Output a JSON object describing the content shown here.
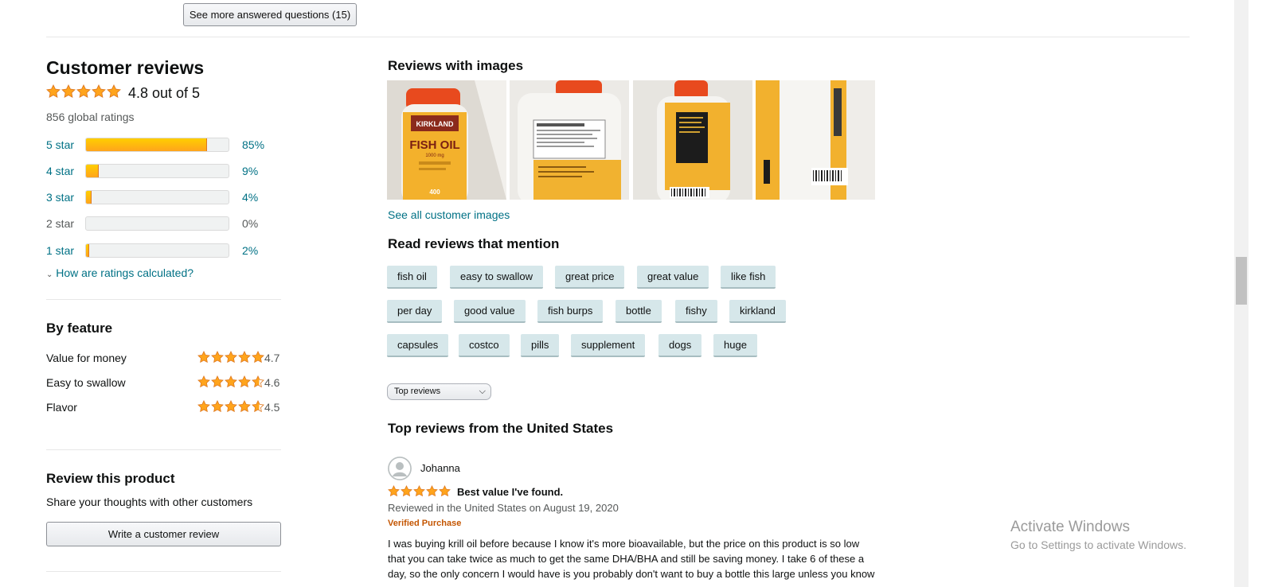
{
  "top_button": "See more answered questions (15)",
  "reviews": {
    "title": "Customer reviews",
    "rating_text": "4.8 out of 5",
    "rating_value": 4.8,
    "global_ratings": "856 global ratings",
    "histogram": [
      {
        "label": "5 star",
        "pct": "85%",
        "value": 85
      },
      {
        "label": "4 star",
        "pct": "9%",
        "value": 9
      },
      {
        "label": "3 star",
        "pct": "4%",
        "value": 4
      },
      {
        "label": "2 star",
        "pct": "0%",
        "value": 0
      },
      {
        "label": "1 star",
        "pct": "2%",
        "value": 2
      }
    ],
    "how_calculated": "How are ratings calculated?"
  },
  "by_feature": {
    "title": "By feature",
    "items": [
      {
        "name": "Value for money",
        "value": "4.7",
        "rating": 4.7
      },
      {
        "name": "Easy to swallow",
        "value": "4.6",
        "rating": 4.6
      },
      {
        "name": "Flavor",
        "value": "4.5",
        "rating": 4.5
      }
    ]
  },
  "review_product": {
    "title": "Review this product",
    "subtitle": "Share your thoughts with other customers",
    "button": "Write a customer review"
  },
  "images_section": {
    "title": "Reviews with images",
    "see_all": "See all customer images",
    "bottle_brand": "KIRKLAND",
    "bottle_name": "FISH OIL",
    "bottle_dose": "1000 mg",
    "bottle_count": "400"
  },
  "mentions": {
    "title": "Read reviews that mention",
    "rows": [
      [
        "fish oil",
        "easy to swallow",
        "great price",
        "great value",
        "like fish"
      ],
      [
        "per day",
        "good value",
        "fish burps",
        "bottle",
        "fishy",
        "kirkland"
      ],
      [
        "capsules",
        "costco",
        "pills",
        "supplement",
        "dogs",
        "huge"
      ]
    ]
  },
  "sort": {
    "selected": "Top reviews"
  },
  "top_reviews": {
    "title": "Top reviews from the United States",
    "review": {
      "author": "Johanna",
      "rating": 5,
      "headline": "Best value I've found.",
      "date": "Reviewed in the United States on August 19, 2020",
      "verified": "Verified Purchase",
      "body_line1": "I was buying krill oil before because I know it's more bioavailable, but the price on this product is so low",
      "body_line2": "that you can take twice as much to get the same DHA/BHA and still be saving money. I take 6 of these a",
      "body_line3": "day, so the only concern I would have is you probably don't want to buy a bottle this large unless you know"
    }
  },
  "watermark": {
    "line1": "Activate Windows",
    "line2": "Go to Settings to activate Windows."
  },
  "colors": {
    "star": "#ffa41c",
    "link": "#007185",
    "verified": "#c45500",
    "chip": "#d6e7ea"
  }
}
